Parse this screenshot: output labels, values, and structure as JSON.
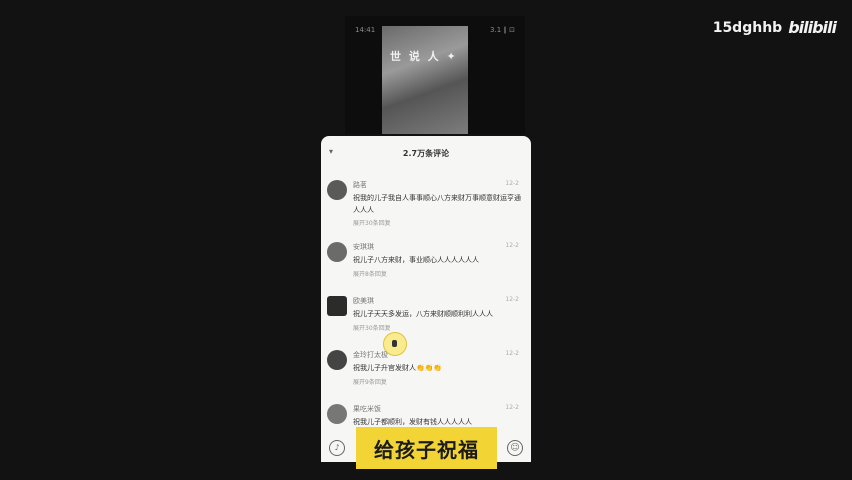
{
  "status": {
    "time": "14:41",
    "right": "3.1  ∥  ⊡"
  },
  "video": {
    "caption": "世 说 人 ✦"
  },
  "watermark": {
    "username": "15dghhb",
    "logo": "bilibili"
  },
  "comments_panel": {
    "title": "2.7万条评论",
    "comments": [
      {
        "user": "路茗",
        "time": "12-2",
        "text": "祝我的儿子我自人事事顺心八方来财万事顺意财运亨通人人人",
        "replies": "展开30条回复"
      },
      {
        "user": "安琪琪",
        "time": "12-2",
        "text": "祝儿子八方来财，事业顺心人人人人人人",
        "replies": "展开8条回复"
      },
      {
        "user": "欧美琪",
        "time": "12-2",
        "text": "祝儿子天天多发运，八方来财顺顺利利人人人",
        "replies": "展开30条回复"
      },
      {
        "user": "金玲打太极",
        "time": "12-2",
        "text": "祝我儿子升官发财人👏👏👏",
        "replies": "展开9条回复"
      },
      {
        "user": "果吃米饭",
        "time": "12-2",
        "text": "祝我儿子都顺利，发财有钱人人人人人",
        "replies": ""
      }
    ]
  },
  "input": {
    "mic_icon": "mic-icon",
    "emoji_icon": "emoji-icon"
  },
  "subtitle": "给孩子祝福"
}
